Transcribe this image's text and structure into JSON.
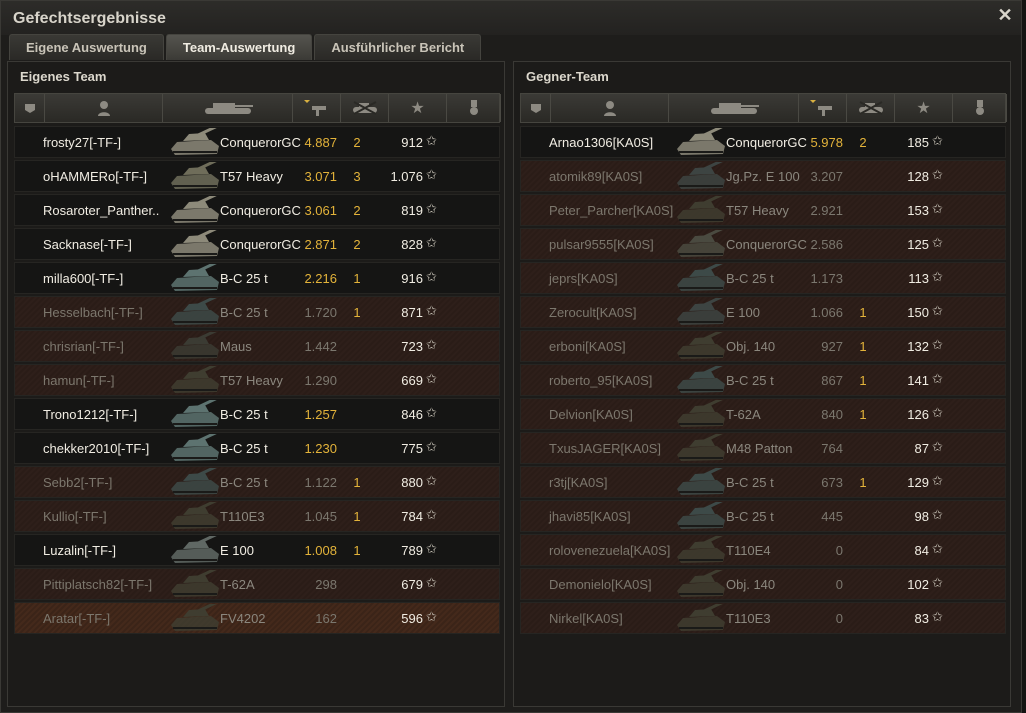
{
  "window": {
    "title": "Gefechtsergebnisse",
    "close_icon": "close-icon"
  },
  "tabs": [
    {
      "label": "Eigene Auswertung",
      "active": false
    },
    {
      "label": "Team-Auswertung",
      "active": true
    },
    {
      "label": "Ausführlicher Bericht",
      "active": false
    }
  ],
  "columns": [
    "squad-icon",
    "player-icon",
    "tank-icon",
    "damage-sort-icon",
    "kills-icon",
    "xp-star-icon",
    "medal-icon"
  ],
  "colors": {
    "damage": "#e3b33a",
    "alive_text": "#f1ede3",
    "dead_text": "#7c776d",
    "panel": "#1c1b19"
  },
  "own_team": {
    "title": "Eigenes Team",
    "rows": [
      {
        "player": "frosty27[-TF-]",
        "tank": "ConquerorGC",
        "damage": "4.887",
        "kills": "2",
        "xp": "912",
        "state": "alive",
        "tankcolor": "#8d8a7a"
      },
      {
        "player": "oHAMMERo[-TF-]",
        "tank": "T57 Heavy",
        "damage": "3.071",
        "kills": "3",
        "xp": "1.076",
        "state": "alive",
        "tankcolor": "#6f6d5a"
      },
      {
        "player": "Rosaroter_Panther..",
        "tank": "ConquerorGC",
        "damage": "3.061",
        "kills": "2",
        "xp": "819",
        "state": "alive",
        "tankcolor": "#8d8a7a"
      },
      {
        "player": "Sacknase[-TF-]",
        "tank": "ConquerorGC",
        "damage": "2.871",
        "kills": "2",
        "xp": "828",
        "state": "alive",
        "tankcolor": "#8d8a7a"
      },
      {
        "player": "milla600[-TF-]",
        "tank": "B-C 25 t",
        "damage": "2.216",
        "kills": "1",
        "xp": "916",
        "state": "alive",
        "tankcolor": "#5d7370"
      },
      {
        "player": "Hesselbach[-TF-]",
        "tank": "B-C 25 t",
        "damage": "1.720",
        "kills": "1",
        "xp": "871",
        "state": "dead",
        "tankcolor": "#3d4a48"
      },
      {
        "player": "chrisrian[-TF-]",
        "tank": "Maus",
        "damage": "1.442",
        "kills": "",
        "xp": "723",
        "state": "dead",
        "tankcolor": "#3b3b33"
      },
      {
        "player": "hamun[-TF-]",
        "tank": "T57 Heavy",
        "damage": "1.290",
        "kills": "",
        "xp": "669",
        "state": "dead",
        "tankcolor": "#3f3d30"
      },
      {
        "player": "Trono1212[-TF-]",
        "tank": "B-C 25 t",
        "damage": "1.257",
        "kills": "",
        "xp": "846",
        "state": "alive",
        "tankcolor": "#5d7370"
      },
      {
        "player": "chekker2010[-TF-]",
        "tank": "B-C 25 t",
        "damage": "1.230",
        "kills": "",
        "xp": "775",
        "state": "alive",
        "tankcolor": "#5d7370"
      },
      {
        "player": "Sebb2[-TF-]",
        "tank": "B-C 25 t",
        "damage": "1.122",
        "kills": "1",
        "xp": "880",
        "state": "dead",
        "tankcolor": "#3d4a48"
      },
      {
        "player": "Kullio[-TF-]",
        "tank": "T110E3",
        "damage": "1.045",
        "kills": "1",
        "xp": "784",
        "state": "dead",
        "tankcolor": "#3f3d30"
      },
      {
        "player": "Luzalin[-TF-]",
        "tank": "E 100",
        "damage": "1.008",
        "kills": "1",
        "xp": "789",
        "state": "alive",
        "tankcolor": "#606864"
      },
      {
        "player": "Pittiplatsch82[-TF-]",
        "tank": "T-62A",
        "damage": "298",
        "kills": "",
        "xp": "679",
        "state": "dead",
        "tankcolor": "#3f3d30"
      },
      {
        "player": "Aratar[-TF-]",
        "tank": "FV4202",
        "damage": "162",
        "kills": "",
        "xp": "596",
        "state": "dead-hl",
        "tankcolor": "#3f3d30"
      }
    ]
  },
  "enemy_team": {
    "title": "Gegner-Team",
    "rows": [
      {
        "player": "Arnao1306[KA0S]",
        "tank": "ConquerorGC",
        "damage": "5.978",
        "kills": "2",
        "xp": "185",
        "state": "alive",
        "tankcolor": "#8d8a7a"
      },
      {
        "player": "atomik89[KA0S]",
        "tank": "Jg.Pz. E 100",
        "damage": "3.207",
        "kills": "",
        "xp": "128",
        "state": "dead",
        "tankcolor": "#3d4442"
      },
      {
        "player": "Peter_Parcher[KA0S]",
        "tank": "T57 Heavy",
        "damage": "2.921",
        "kills": "",
        "xp": "153",
        "state": "dead",
        "tankcolor": "#3f3d30"
      },
      {
        "player": "pulsar9555[KA0S]",
        "tank": "ConquerorGC",
        "damage": "2.586",
        "kills": "",
        "xp": "125",
        "state": "dead",
        "tankcolor": "#4a4a40"
      },
      {
        "player": "jeprs[KA0S]",
        "tank": "B-C 25 t",
        "damage": "1.173",
        "kills": "",
        "xp": "113",
        "state": "dead",
        "tankcolor": "#3d4a48"
      },
      {
        "player": "Zerocult[KA0S]",
        "tank": "E 100",
        "damage": "1.066",
        "kills": "1",
        "xp": "150",
        "state": "dead",
        "tankcolor": "#3d4442"
      },
      {
        "player": "erboni[KA0S]",
        "tank": "Obj. 140",
        "damage": "927",
        "kills": "1",
        "xp": "132",
        "state": "dead",
        "tankcolor": "#3f3d30"
      },
      {
        "player": "roberto_95[KA0S]",
        "tank": "B-C 25 t",
        "damage": "867",
        "kills": "1",
        "xp": "141",
        "state": "dead",
        "tankcolor": "#3d4a48"
      },
      {
        "player": "Delvion[KA0S]",
        "tank": "T-62A",
        "damage": "840",
        "kills": "1",
        "xp": "126",
        "state": "dead",
        "tankcolor": "#3f3d30"
      },
      {
        "player": "TxusJAGER[KA0S]",
        "tank": "M48 Patton",
        "damage": "764",
        "kills": "",
        "xp": "87",
        "state": "dead",
        "tankcolor": "#3f3d30"
      },
      {
        "player": "r3tj[KA0S]",
        "tank": "B-C 25 t",
        "damage": "673",
        "kills": "1",
        "xp": "129",
        "state": "dead",
        "tankcolor": "#3d4a48"
      },
      {
        "player": "jhavi85[KA0S]",
        "tank": "B-C 25 t",
        "damage": "445",
        "kills": "",
        "xp": "98",
        "state": "dead",
        "tankcolor": "#3d4a48"
      },
      {
        "player": "rolovenezuela[KA0S]",
        "tank": "T110E4",
        "damage": "0",
        "kills": "",
        "xp": "84",
        "state": "dead",
        "tankcolor": "#3f3d30"
      },
      {
        "player": "Demonielo[KA0S]",
        "tank": "Obj. 140",
        "damage": "0",
        "kills": "",
        "xp": "102",
        "state": "dead",
        "tankcolor": "#3f3d30"
      },
      {
        "player": "Nirkel[KA0S]",
        "tank": "T110E3",
        "damage": "0",
        "kills": "",
        "xp": "83",
        "state": "dead",
        "tankcolor": "#3f3d30"
      }
    ]
  }
}
